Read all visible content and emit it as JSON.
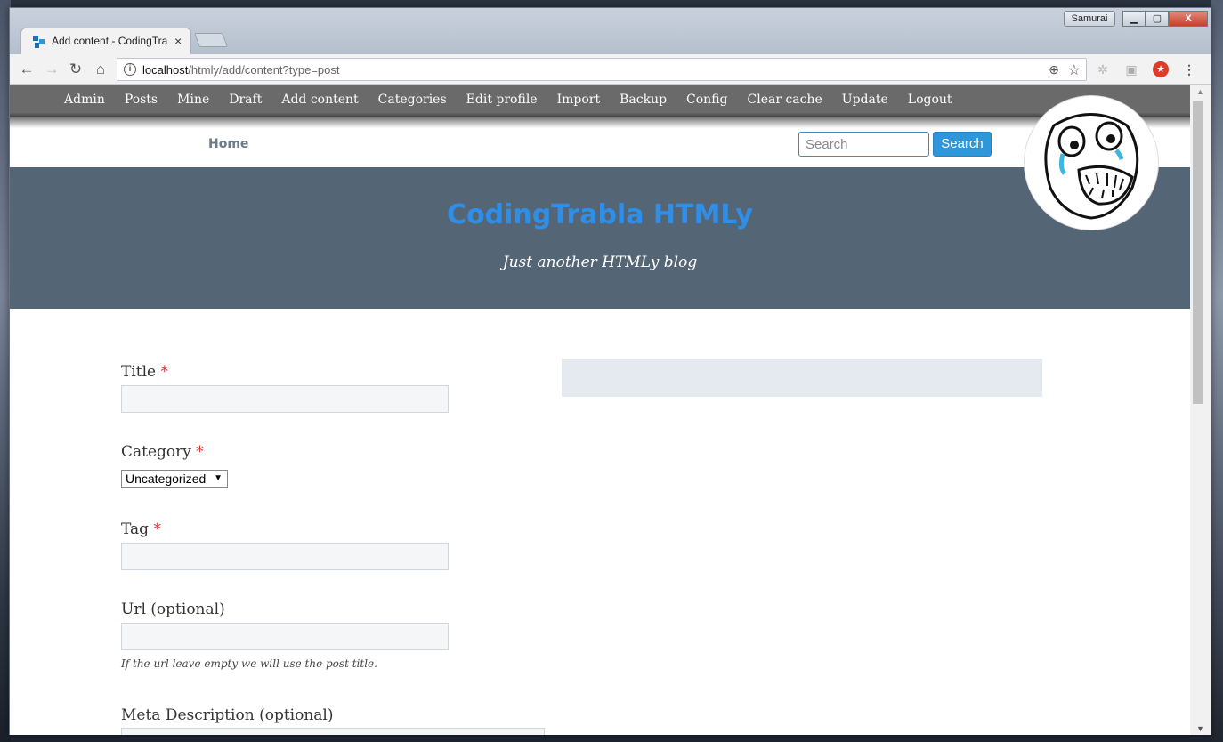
{
  "window": {
    "profile": "Samurai",
    "minimize": "▁",
    "maximize": "▢",
    "close": "X"
  },
  "tab": {
    "title": "Add content - CodingTrabla",
    "close": "×",
    "favicon": "htmly-icon"
  },
  "toolbar": {
    "url_host": "localhost",
    "url_path": "/htmly/add/content?type=post",
    "back": "←",
    "forward": "→",
    "reload": "↻",
    "home": "⌂",
    "info": "i",
    "zoom": "⊕",
    "star": "☆",
    "menu": "⋮"
  },
  "adminbar": {
    "items": [
      "Admin",
      "Posts",
      "Mine",
      "Draft",
      "Add content",
      "Categories",
      "Edit profile",
      "Import",
      "Backup",
      "Config",
      "Clear cache",
      "Update",
      "Logout"
    ]
  },
  "sitenav": {
    "home": "Home",
    "search_placeholder": "Search",
    "search_button": "Search"
  },
  "hero": {
    "title": "CodingTrabla HTMLy",
    "tagline": "Just another HTMLy blog"
  },
  "form": {
    "title_label": "Title",
    "category_label": "Category",
    "category_value": "Uncategorized",
    "tag_label": "Tag",
    "url_label": "Url (optional)",
    "url_help": "If the url leave empty we will use the post title.",
    "meta_label": "Meta Description (optional)",
    "required_mark": "*"
  },
  "colors": {
    "hero_bg": "#546575",
    "title_color": "#2f8fe8",
    "adminbar_bg": "#6a6a6a",
    "search_btn": "#2f96d9"
  }
}
